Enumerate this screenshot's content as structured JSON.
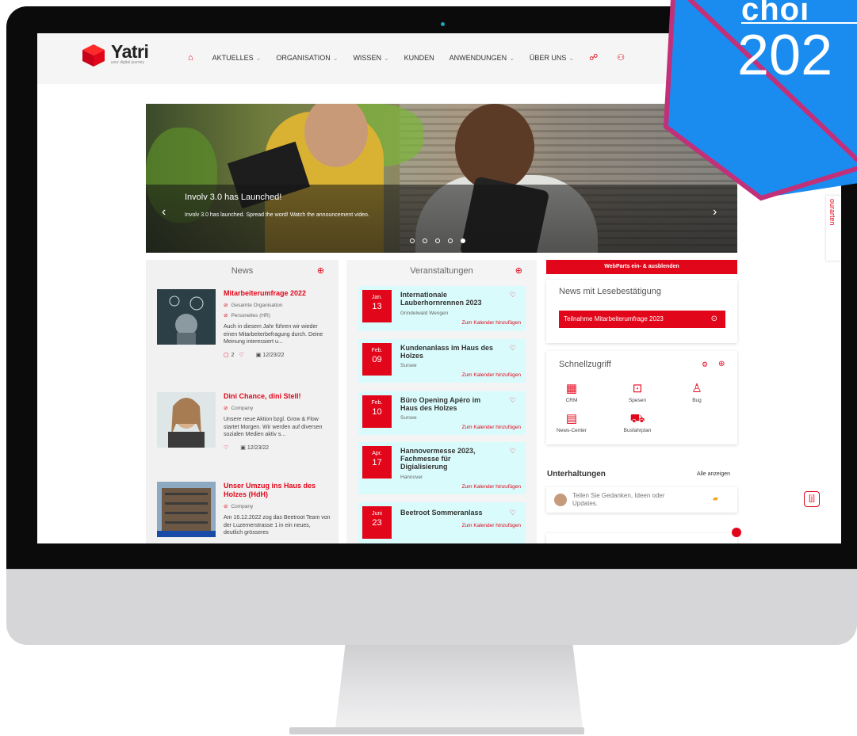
{
  "brand": {
    "name": "Yatri",
    "tagline": "your digital journey"
  },
  "nav": {
    "items": [
      {
        "label": "AKTUELLES",
        "dropdown": true
      },
      {
        "label": "ORGANISATION",
        "dropdown": true
      },
      {
        "label": "WISSEN",
        "dropdown": true
      },
      {
        "label": "KUNDEN",
        "dropdown": false
      },
      {
        "label": "ANWENDUNGEN",
        "dropdown": true
      },
      {
        "label": "ÜBER UNS",
        "dropdown": true
      }
    ],
    "icons": [
      "home-icon",
      "sitemap-icon",
      "user-switch-icon"
    ]
  },
  "hero": {
    "title": "Involv 3.0 has Launched!",
    "subtitle": "Involv 3.0 has launched. Spread the word! Watch the announcement video.",
    "slides": 5,
    "active_slide": 5
  },
  "news": {
    "heading": "News",
    "items": [
      {
        "title": "Mitarbeiterumfrage 2022",
        "tags": [
          "Gesamte Organisation",
          "Personelles (HR)"
        ],
        "text": "Auch in diesem Jahr führen wir wieder einen Mitarbeiterbefragung durch. Deine Meinung interessiert u...",
        "comments": "2",
        "date": "12/23/22"
      },
      {
        "title": "Dini Chance, dini Stell!",
        "tags": [
          "Company"
        ],
        "text": "Unsere neue Aktion bzgl. Grow & Flow startet Morgen. Wir werden auf diversen sozialen Medien aktiv s...",
        "comments": "",
        "date": "12/23/22"
      },
      {
        "title": "Unser Umzug ins Haus des Holzes (HdH)",
        "tags": [
          "Company"
        ],
        "text": "Am 16.12.2022 zog das Beetroot Team von der Luzernerstrasse 1 in ein neues, deutlich grösseres",
        "comments": "",
        "date": ""
      }
    ]
  },
  "events": {
    "heading": "Veranstaltungen",
    "add_label": "Zum Kalender hinzufügen",
    "items": [
      {
        "month": "Jan.",
        "day": "13",
        "title": "Internationale Lauberhornrennen 2023",
        "location": "Grindelwald Wengen"
      },
      {
        "month": "Feb.",
        "day": "09",
        "title": "Kundenanlass im Haus des Holzes",
        "location": "Sursee"
      },
      {
        "month": "Feb.",
        "day": "10",
        "title": "Büro Opening Apéro im Haus des Holzes",
        "location": "Sursee"
      },
      {
        "month": "Apr.",
        "day": "17",
        "title": "Hannovermesse 2023, Fachmesse für Digialisierung",
        "location": "Hannover"
      },
      {
        "month": "Juni",
        "day": "23",
        "title": "Beetroot Sommeranlass",
        "location": ""
      }
    ]
  },
  "sidebar": {
    "webparts_button": "WebParts ein- & ausblenden",
    "read_news_title": "News mit Lesebestätigung",
    "read_news_button": "Teilnahme Mitarbeiterumfrage 2023",
    "quick_title": "Schnellzugriff",
    "quick_items": [
      {
        "label": "CRM",
        "icon": "crm-icon"
      },
      {
        "label": "Spesen",
        "icon": "money-icon"
      },
      {
        "label": "Bug",
        "icon": "bug-user-icon"
      },
      {
        "label": "News-Center",
        "icon": "news-icon"
      },
      {
        "label": "Busfahrplan",
        "icon": "bus-icon"
      }
    ],
    "conv_title": "Unterhaltungen",
    "conv_all": "Alle anzeigen",
    "conv_placeholder": "Teilen Sie Gedanken, Ideen oder Updates.",
    "side_tab": "ourarten"
  },
  "badge": {
    "line1": "choi",
    "line2": "202"
  },
  "colors": {
    "accent": "#e2061a",
    "event_bg": "#d9fbfc",
    "badge_blue": "#1a8cf0",
    "badge_frame": "#c2307a"
  }
}
